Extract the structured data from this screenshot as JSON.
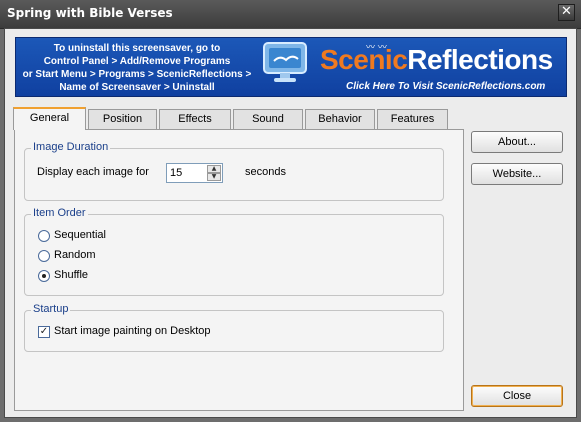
{
  "window": {
    "title": "Spring with Bible Verses",
    "close_label": "✕"
  },
  "banner": {
    "uninstall_lines": [
      "To uninstall this screensaver, go to",
      "Control Panel > Add/Remove Programs",
      "or Start Menu > Programs > ScenicReflections >",
      "Name of Screensaver > Uninstall"
    ],
    "logo_part1": "Scenic",
    "logo_part2": "Reflections",
    "link_text": "Click Here To Visit ScenicReflections.com"
  },
  "tabs": [
    {
      "label": "General",
      "active": true
    },
    {
      "label": "Position",
      "active": false
    },
    {
      "label": "Effects",
      "active": false
    },
    {
      "label": "Sound",
      "active": false
    },
    {
      "label": "Behavior",
      "active": false
    },
    {
      "label": "Features",
      "active": false
    }
  ],
  "image_duration": {
    "group_label": "Image Duration",
    "prefix": "Display each image for",
    "value": "15",
    "suffix": "seconds"
  },
  "item_order": {
    "group_label": "Item Order",
    "options": [
      {
        "label": "Sequential",
        "selected": false
      },
      {
        "label": "Random",
        "selected": false
      },
      {
        "label": "Shuffle",
        "selected": true
      }
    ]
  },
  "startup": {
    "group_label": "Startup",
    "checkbox_label": "Start image painting on Desktop",
    "checked": true
  },
  "buttons": {
    "about": "About...",
    "website": "Website...",
    "close": "Close"
  }
}
